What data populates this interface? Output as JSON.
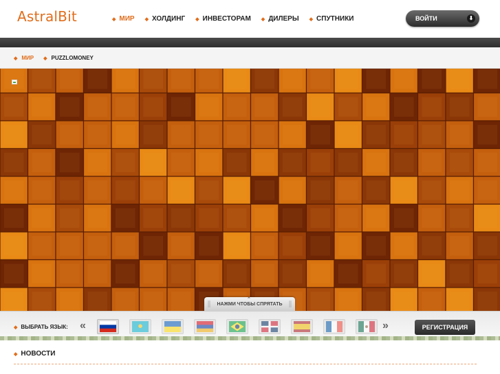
{
  "header": {
    "logo": "AstralBit",
    "nav": [
      {
        "label": "МИР",
        "active": true
      },
      {
        "label": "ХОЛДИНГ",
        "active": false
      },
      {
        "label": "ИНВЕСТОРАМ",
        "active": false
      },
      {
        "label": "ДИЛЕРЫ",
        "active": false
      },
      {
        "label": "СПУТНИКИ",
        "active": false
      }
    ],
    "login_label": "ВОЙТИ",
    "login_icon": "arrow-down-circle-icon"
  },
  "breadcrumb": [
    {
      "label": "МИР",
      "link": true
    },
    {
      "label": "PUZZLOMONEY",
      "link": false
    }
  ],
  "hero": {
    "hide_label": "НАЖМИ ЧТОБЫ СПРЯТАТЬ"
  },
  "langbar": {
    "label": "ВЫБРАТЬ ЯЗЫК:",
    "prev": "«",
    "next": "»",
    "flags": [
      {
        "name": "russia",
        "dim": false
      },
      {
        "name": "kazakhstan",
        "dim": true
      },
      {
        "name": "ukraine",
        "dim": true
      },
      {
        "name": "armenia",
        "dim": true
      },
      {
        "name": "brazil",
        "dim": true
      },
      {
        "name": "dominican-republic",
        "dim": true
      },
      {
        "name": "spain",
        "dim": true
      },
      {
        "name": "france",
        "dim": true
      },
      {
        "name": "mexico",
        "dim": true
      }
    ],
    "register_label": "РЕГИСТРАЦИЯ"
  },
  "news": {
    "title": "НОВОСТИ"
  },
  "colors": {
    "accent": "#e06e1c",
    "dark": "#2e2e2e"
  }
}
